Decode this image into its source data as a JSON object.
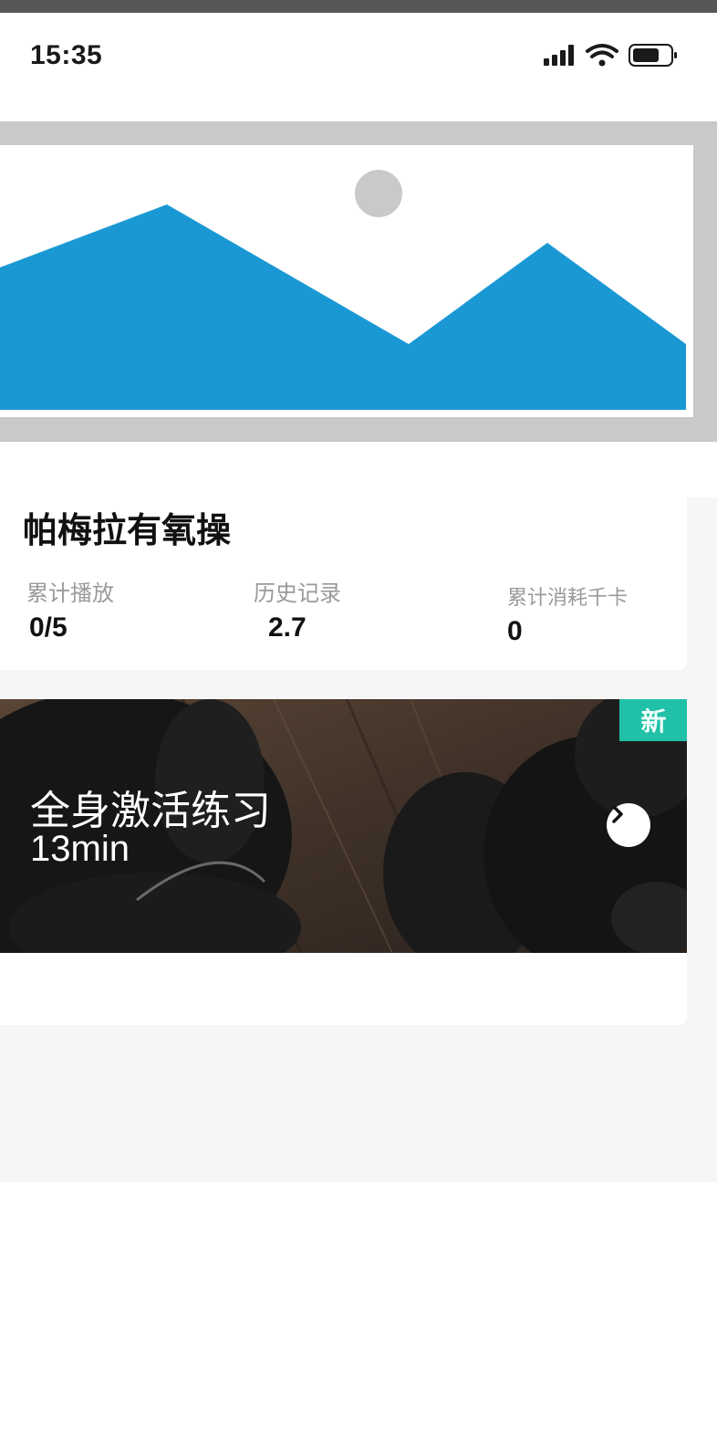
{
  "status_bar": {
    "time": "15:35",
    "icons": [
      "cellular-signal-icon",
      "wifi-icon",
      "battery-icon"
    ]
  },
  "banner": {
    "icon": "image-placeholder-icon"
  },
  "course": {
    "title": "帕梅拉有氧操",
    "stats": [
      {
        "label": "累计播放",
        "value": "0/5"
      },
      {
        "label": "历史记录",
        "value": "2.7"
      },
      {
        "label": "累计消耗千卡",
        "value": "0"
      }
    ]
  },
  "lesson": {
    "title": "全身激活练习",
    "duration": "13min",
    "badge": "新",
    "action_icon": "chevron-right-icon"
  },
  "colors": {
    "placeholder_gray": "#c9c9c9",
    "placeholder_blue": "#1a98d4",
    "badge_teal": "#21c1a8",
    "page_background": "#f6f6f6"
  }
}
